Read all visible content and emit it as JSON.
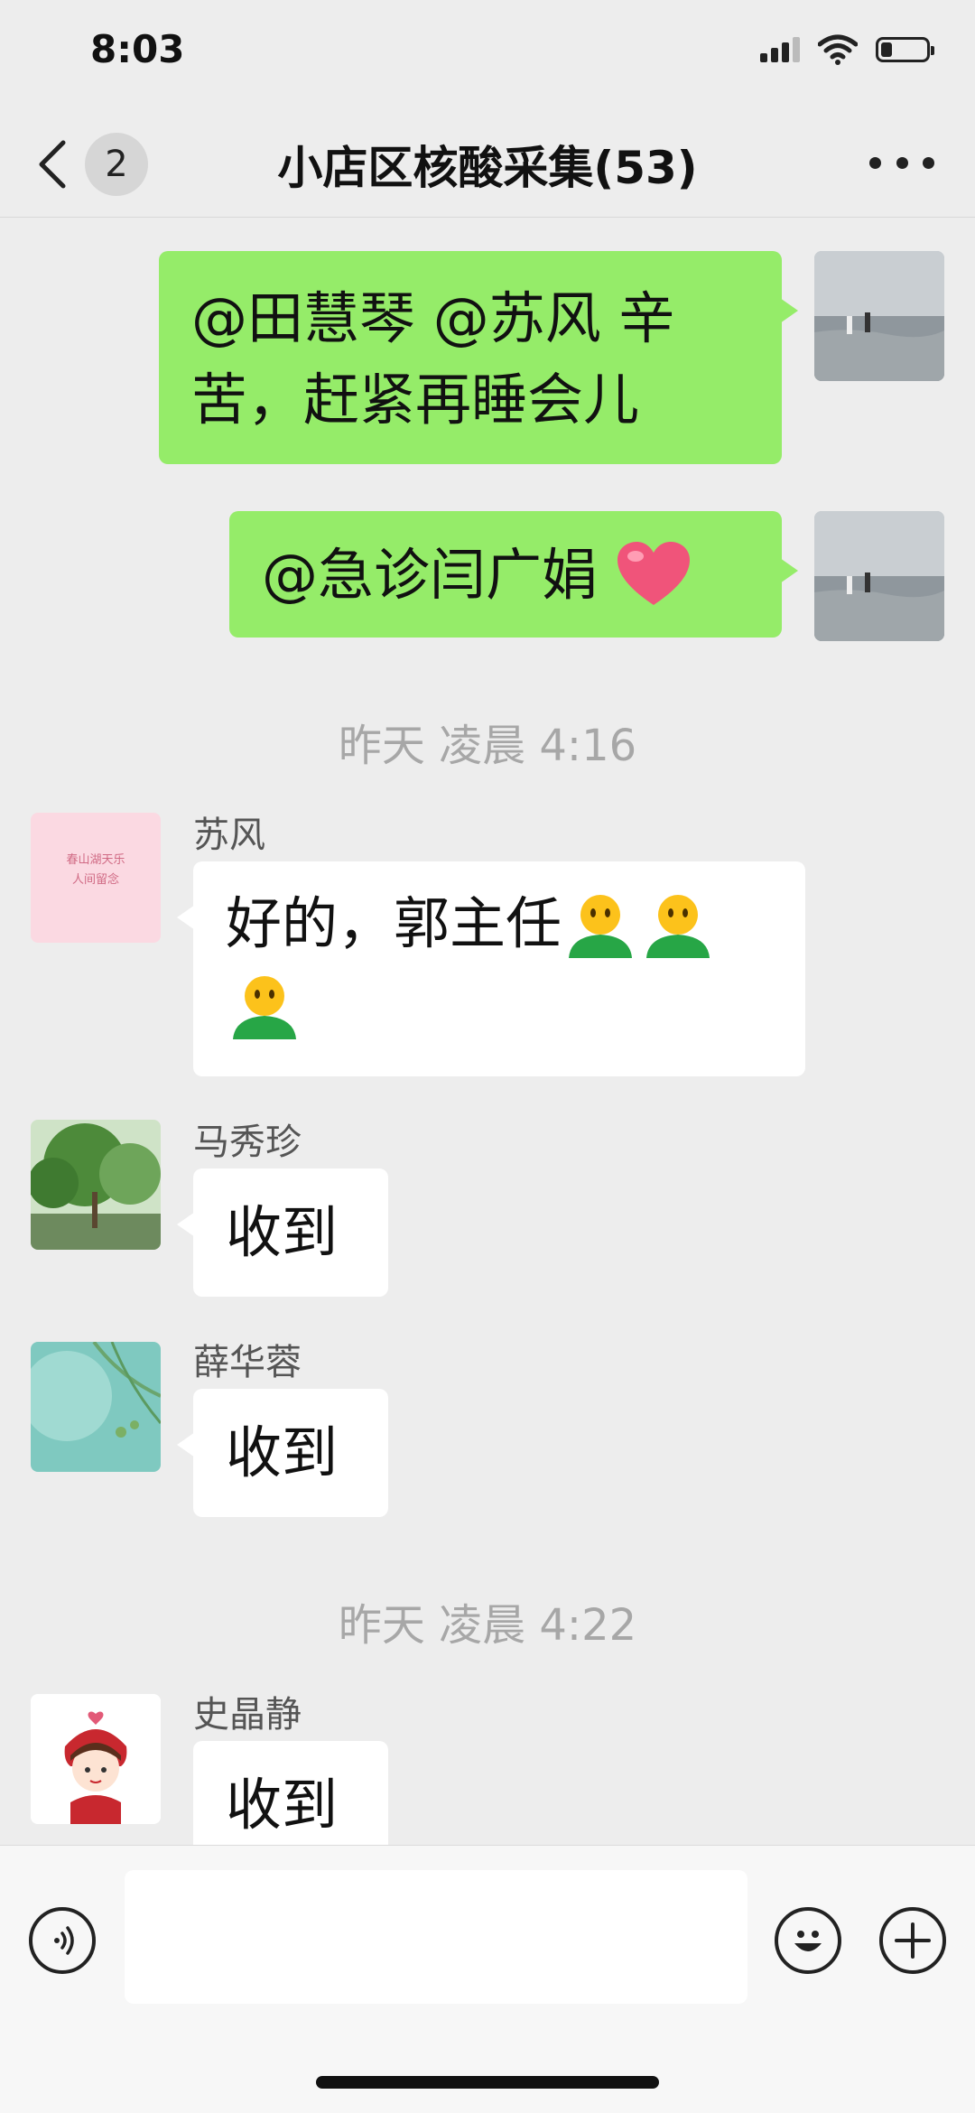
{
  "status_bar": {
    "time": "8:03"
  },
  "nav": {
    "back_count": "2",
    "title": "小店区核酸采集(53)"
  },
  "messages_out": [
    {
      "text_line1": "@田慧琴 @苏风 辛",
      "text_line2": "苦，赶紧再睡会儿"
    },
    {
      "text": "@急诊闫广娟 "
    }
  ],
  "timestamps": [
    "昨天 凌晨 4:16",
    "昨天 凌晨 4:22"
  ],
  "messages_in": [
    {
      "sender": "苏风",
      "text": "好的，郭主任",
      "avatar_text_1": "春山湖天乐",
      "avatar_text_2": "人间留念"
    },
    {
      "sender": "马秀珍",
      "text": "收到"
    },
    {
      "sender": "薛华蓉",
      "text": "收到"
    },
    {
      "sender": "史晶静",
      "text": "收到"
    }
  ],
  "colors": {
    "bubble_out": "#95ec69",
    "bubble_in": "#ffffff",
    "background": "#ededed"
  }
}
